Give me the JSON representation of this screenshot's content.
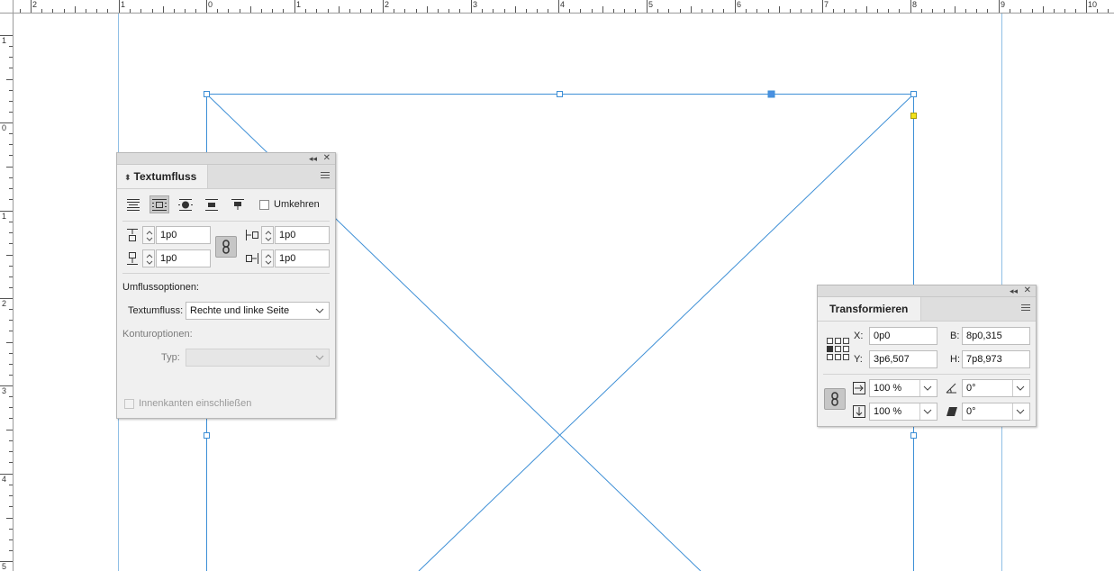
{
  "rulers": {
    "top_labels": [
      "2",
      "1",
      "0",
      "1",
      "2",
      "3",
      "4",
      "5",
      "6",
      "7",
      "8",
      "9",
      "10"
    ],
    "left_labels": [
      "1",
      "0",
      "1",
      "2",
      "3",
      "4",
      "5"
    ]
  },
  "textwrap_panel": {
    "collapse_icon": "double-left-arrow-icon",
    "close_icon": "close-icon",
    "tab_label": "Textumfluss",
    "wrap_buttons": [
      {
        "name": "no-wrap",
        "icon": "no-wrap-icon"
      },
      {
        "name": "wrap-around-bounding-box",
        "icon": "wrap-bbox-icon",
        "active": true
      },
      {
        "name": "wrap-around-object-shape",
        "icon": "wrap-shape-icon"
      },
      {
        "name": "jump-object",
        "icon": "jump-object-icon"
      },
      {
        "name": "jump-to-next-column",
        "icon": "jump-column-icon"
      }
    ],
    "invert_label": "Umkehren",
    "offsets": {
      "top": "1p0",
      "bottom": "1p0",
      "left": "1p0",
      "right": "1p0"
    },
    "wrap_options_heading": "Umflussoptionen:",
    "wrap_to_label": "Textumfluss:",
    "wrap_to_value": "Rechte und linke Seite",
    "contour_heading": "Konturoptionen:",
    "type_label": "Typ:",
    "type_value": "",
    "include_inside_edges_label": "Innenkanten einschließen"
  },
  "transform_panel": {
    "collapse_icon": "double-left-arrow-icon",
    "close_icon": "close-icon",
    "tab_label": "Transformieren",
    "x_label": "X:",
    "x_value": "0p0",
    "y_label": "Y:",
    "y_value": "3p6,507",
    "w_label": "B:",
    "w_value": "8p0,315",
    "h_label": "H:",
    "h_value": "7p8,973",
    "scale_x_value": "100 %",
    "scale_y_value": "100 %",
    "rotation_value": "0°",
    "shear_value": "0°"
  },
  "colors": {
    "guide": "#8fbfe6",
    "frame": "#3d8fd6",
    "selected_handle": "#4a90e2",
    "yellow_handle": "#f2e21b"
  }
}
